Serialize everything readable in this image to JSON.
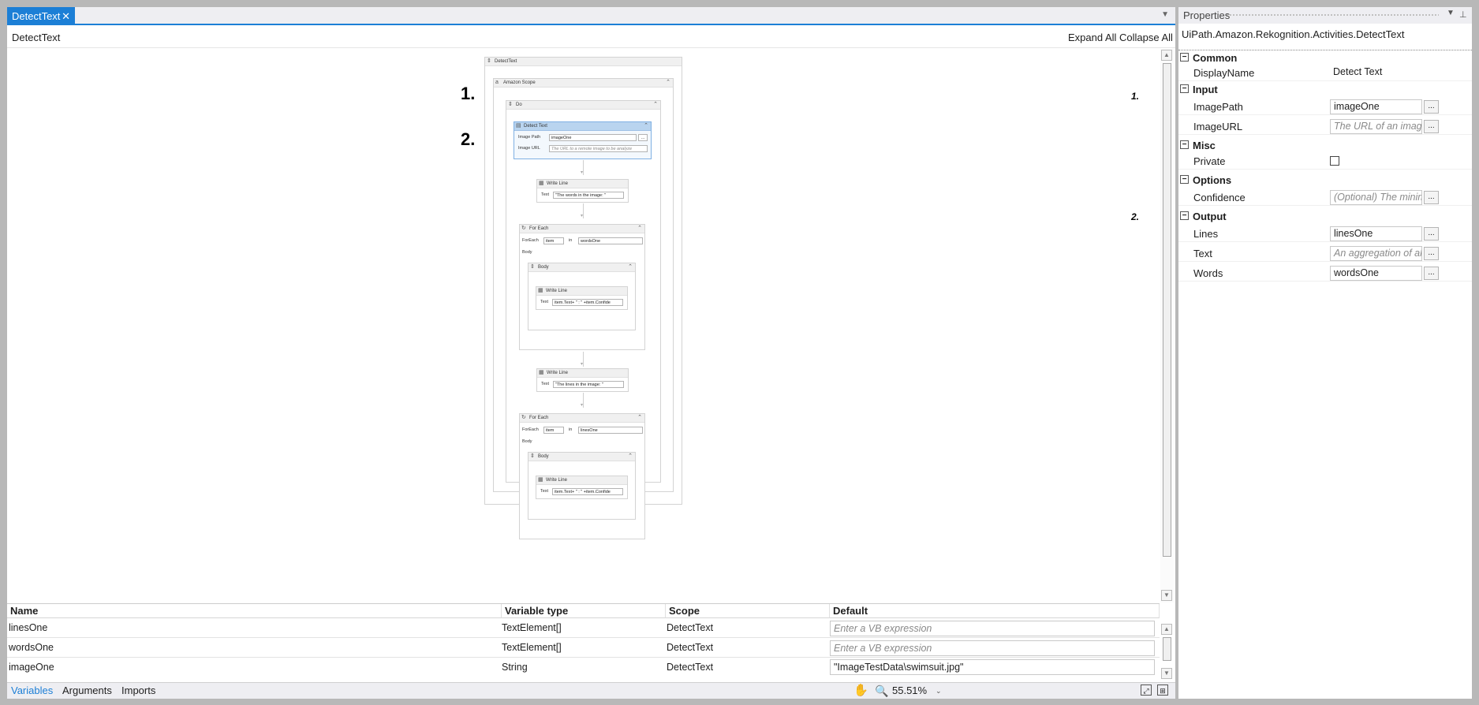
{
  "designer": {
    "tab_label": "DetectText",
    "tab_close": "✕",
    "breadcrumb": "DetectText",
    "expand_all": "Expand All",
    "collapse_all": "Collapse All"
  },
  "annotations": {
    "one": "1.",
    "two": "2."
  },
  "workflow": {
    "root": "DetectText",
    "scope": "Amazon Scope",
    "do": "Do",
    "detect": {
      "title": "Detect Text",
      "image_path_label": "Image Path",
      "image_path_value": "imageOne",
      "image_url_label": "Image URL",
      "image_url_placeholder": "The URL to a remote image to be analyze",
      "browse": "..."
    },
    "write_line_1": {
      "title": "Write Line",
      "text_label": "Text",
      "text_value": "\"The words in the image: \""
    },
    "foreach_1": {
      "title": "For Each",
      "foreach_label": "ForEach",
      "item": "item",
      "in_label": "in",
      "collection": "wordsOne",
      "body_label": "Body",
      "body_title": "Body",
      "inner_title": "Write Line",
      "inner_text_label": "Text",
      "inner_text_value": "item.Text+ \" : \" +item.Confide"
    },
    "write_line_2": {
      "title": "Write Line",
      "text_label": "Text",
      "text_value": "\"The lines in the image: \""
    },
    "foreach_2": {
      "title": "For Each",
      "foreach_label": "ForEach",
      "item": "item",
      "in_label": "in",
      "collection": "linesOne",
      "body_label": "Body",
      "body_title": "Body",
      "inner_title": "Write Line",
      "inner_text_label": "Text",
      "inner_text_value": "item.Text+ \" : \" +item.Confide"
    }
  },
  "variables": {
    "columns": [
      "Name",
      "Variable type",
      "Scope",
      "Default"
    ],
    "rows": [
      {
        "name": "linesOne",
        "type": "TextElement[]",
        "scope": "DetectText",
        "default": "Enter a VB expression",
        "placeholder": true
      },
      {
        "name": "wordsOne",
        "type": "TextElement[]",
        "scope": "DetectText",
        "default": "Enter a VB expression",
        "placeholder": true
      },
      {
        "name": "imageOne",
        "type": "String",
        "scope": "DetectText",
        "default": "\"ImageTestData\\swimsuit.jpg\"",
        "placeholder": false
      }
    ]
  },
  "bottom": {
    "tabs": [
      "Variables",
      "Arguments",
      "Imports"
    ],
    "zoom": "55.51%"
  },
  "properties": {
    "title": "Properties",
    "type_name": "UiPath.Amazon.Rekognition.Activities.DetectText",
    "categories": {
      "common": "Common",
      "input": "Input",
      "misc": "Misc",
      "options": "Options",
      "output": "Output"
    },
    "display_name_label": "DisplayName",
    "display_name_value": "Detect Text",
    "image_path_label": "ImagePath",
    "image_path_value": "imageOne",
    "image_url_label": "ImageURL",
    "image_url_placeholder": "The URL of an image",
    "private_label": "Private",
    "confidence_label": "Confidence",
    "confidence_placeholder": "(Optional) The minim",
    "lines_label": "Lines",
    "lines_value": "linesOne",
    "text_label": "Text",
    "text_placeholder": "An aggregation of all",
    "words_label": "Words",
    "words_value": "wordsOne",
    "browse": "...",
    "collapse_glyph": "⊟"
  },
  "colors": {
    "accent": "#1c7fd6",
    "frame": "#b8b8b8"
  },
  "icons": [
    "close-icon",
    "dropdown-icon",
    "hand-icon",
    "search-icon",
    "fit-screen-icon",
    "overview-icon",
    "pin-icon"
  ]
}
